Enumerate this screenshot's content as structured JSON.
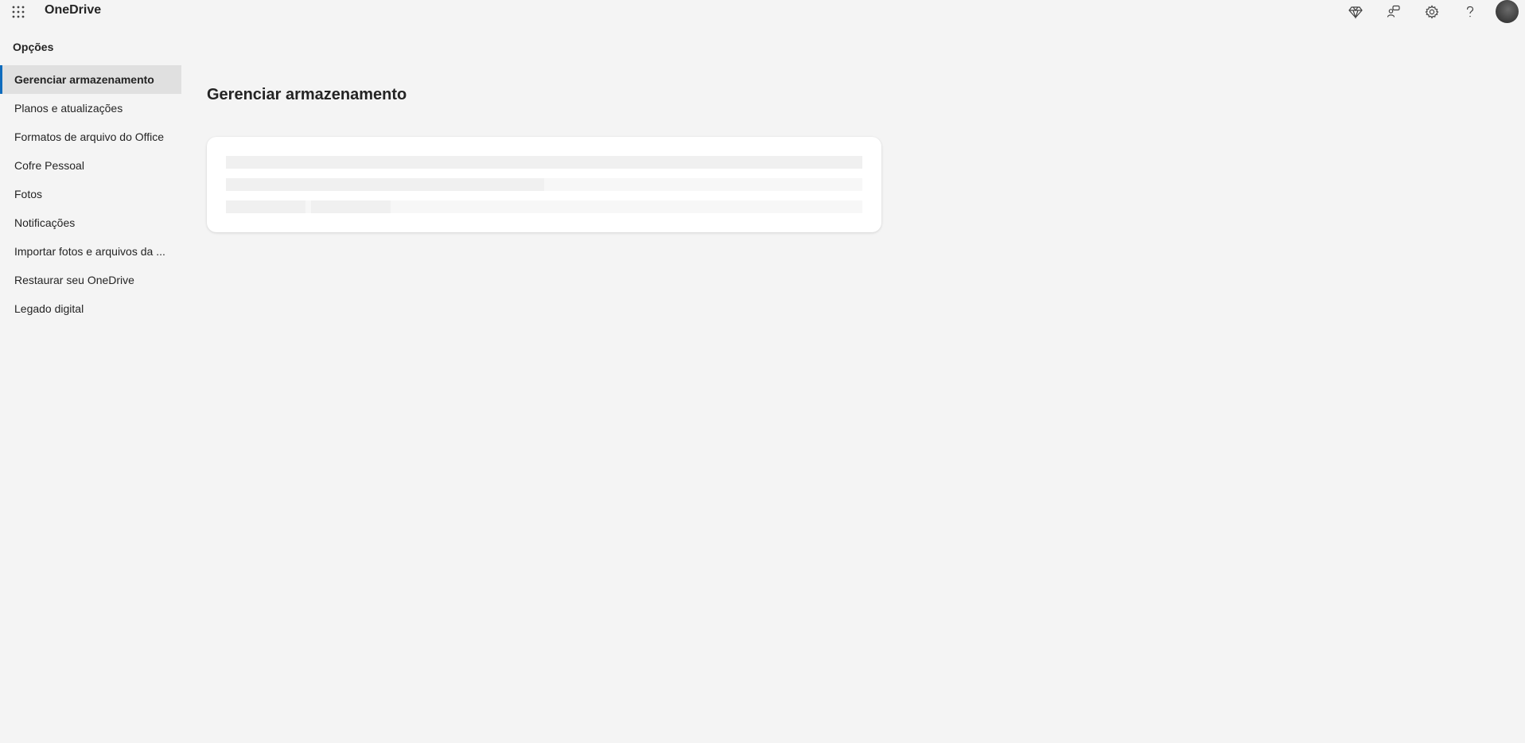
{
  "app": {
    "title": "OneDrive"
  },
  "header": {
    "icons": [
      "premium-diamond-icon",
      "share-people-icon",
      "settings-gear-icon",
      "help-icon"
    ]
  },
  "sidebar": {
    "title": "Opções",
    "items": [
      {
        "label": "Gerenciar armazenamento",
        "active": true
      },
      {
        "label": "Planos e atualizações"
      },
      {
        "label": "Formatos de arquivo do Office"
      },
      {
        "label": "Cofre Pessoal"
      },
      {
        "label": "Fotos"
      },
      {
        "label": "Notificações"
      },
      {
        "label": "Importar fotos e arquivos da ..."
      },
      {
        "label": "Restaurar seu OneDrive"
      },
      {
        "label": "Legado digital"
      }
    ]
  },
  "main": {
    "title": "Gerenciar armazenamento",
    "loading": true
  },
  "colors": {
    "accent": "#0f6cbd",
    "background": "#f4f4f4",
    "card": "#ffffff",
    "skeleton": "#f0f0f0",
    "skeleton_light": "#f7f7f7"
  }
}
